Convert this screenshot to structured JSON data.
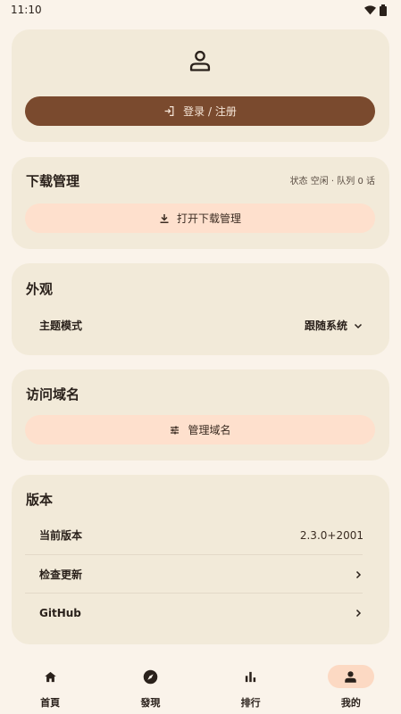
{
  "status_bar": {
    "time": "11:10"
  },
  "account": {
    "login_label": "登录 / 注册",
    "login_button_color": "#7a4a2e"
  },
  "downloads": {
    "title": "下载管理",
    "status": "状态 空闲 · 队列 0 话",
    "open_label": "打开下载管理"
  },
  "appearance": {
    "title": "外观",
    "theme_label": "主题模式",
    "theme_value": "跟随系统"
  },
  "domain": {
    "title": "访问域名",
    "manage_label": "管理域名"
  },
  "version": {
    "title": "版本",
    "current_label": "当前版本",
    "current_value": "2.3.0+2001",
    "check_update_label": "检查更新",
    "github_label": "GitHub"
  },
  "nav": {
    "items": [
      {
        "label": "首頁",
        "icon": "home-icon"
      },
      {
        "label": "發現",
        "icon": "compass-icon"
      },
      {
        "label": "排行",
        "icon": "bar-chart-icon"
      },
      {
        "label": "我的",
        "icon": "person-icon",
        "active": true
      }
    ]
  }
}
